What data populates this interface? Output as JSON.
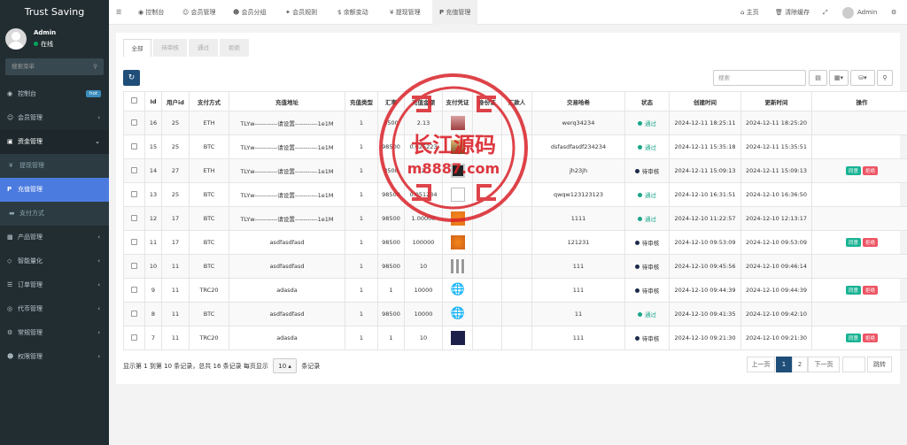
{
  "app": {
    "title": "Trust Saving"
  },
  "user": {
    "name": "Admin",
    "status": "在线"
  },
  "sidebar": {
    "search_placeholder": "搜索菜单",
    "items": [
      {
        "label": "控制台",
        "badge": "hot"
      },
      {
        "label": "会员管理"
      },
      {
        "label": "资金管理"
      },
      {
        "label": "提现管理"
      },
      {
        "label": "充值管理"
      },
      {
        "label": "支付方式"
      },
      {
        "label": "产品管理"
      },
      {
        "label": "智能量化"
      },
      {
        "label": "订单管理"
      },
      {
        "label": "代币管理"
      },
      {
        "label": "常规管理"
      },
      {
        "label": "权限管理"
      }
    ]
  },
  "topnav": {
    "tabs": [
      "控制台",
      "会员管理",
      "会员分组",
      "会员规则",
      "余额变动",
      "提现管理",
      "充值管理"
    ],
    "right": {
      "home": "主页",
      "clear_cache": "清除缓存",
      "admin": "Admin"
    }
  },
  "filter_tabs": [
    "全部",
    "待审核",
    "通过",
    "拒绝"
  ],
  "toolbar": {
    "search_placeholder": "搜索"
  },
  "table": {
    "headers": [
      "Id",
      "用户id",
      "支付方式",
      "充值地址",
      "充值类型",
      "汇率",
      "充值金额",
      "支付凭证",
      "身份证",
      "汇款人",
      "交易哈希",
      "状态",
      "创建时间",
      "更新时间",
      "操作"
    ],
    "rows": [
      {
        "id": "16",
        "uid": "25",
        "pay": "ETH",
        "addr": "TLYw-----------请设置-----------1e1M",
        "type": "1",
        "rate": "3500",
        "amount": "2.13",
        "hash": "werq34234",
        "status": "通过",
        "created": "2024-12-11 18:25:11",
        "updated": "2024-12-11 18:25:20",
        "ops": false
      },
      {
        "id": "15",
        "uid": "25",
        "pay": "BTC",
        "addr": "TLYw-----------请设置-----------1e1M",
        "type": "1",
        "rate": "98500",
        "amount": "0.025223",
        "hash": "dsfasdfasdf234234",
        "status": "通过",
        "created": "2024-12-11 15:35:18",
        "updated": "2024-12-11 15:35:51",
        "ops": false
      },
      {
        "id": "14",
        "uid": "27",
        "pay": "ETH",
        "addr": "TLYw-----------请设置-----------1e1M",
        "type": "1",
        "rate": "3500",
        "amount": "2",
        "hash": "jh23jh",
        "status": "待审核",
        "created": "2024-12-11 15:09:13",
        "updated": "2024-12-11 15:09:13",
        "ops": true
      },
      {
        "id": "13",
        "uid": "25",
        "pay": "BTC",
        "addr": "TLYw-----------请设置-----------1e1M",
        "type": "1",
        "rate": "98500",
        "amount": "0.051234",
        "hash": "qwqw123123123",
        "status": "通过",
        "created": "2024-12-10 16:31:51",
        "updated": "2024-12-10 16:36:50",
        "ops": false
      },
      {
        "id": "12",
        "uid": "17",
        "pay": "BTC",
        "addr": "TLYw-----------请设置-----------1e1M",
        "type": "1",
        "rate": "98500",
        "amount": "1.00000",
        "hash": "1111",
        "status": "通过",
        "created": "2024-12-10 11:22:57",
        "updated": "2024-12-10 12:13:17",
        "ops": false
      },
      {
        "id": "11",
        "uid": "17",
        "pay": "BTC",
        "addr": "asdfasdfasd",
        "type": "1",
        "rate": "98500",
        "amount": "100000",
        "hash": "121231",
        "status": "待审核",
        "created": "2024-12-10 09:53:09",
        "updated": "2024-12-10 09:53:09",
        "ops": true
      },
      {
        "id": "10",
        "uid": "11",
        "pay": "BTC",
        "addr": "asdfasdfasd",
        "type": "1",
        "rate": "98500",
        "amount": "10",
        "hash": "111",
        "status": "待审核",
        "created": "2024-12-10 09:45:56",
        "updated": "2024-12-10 09:46:14",
        "ops": false
      },
      {
        "id": "9",
        "uid": "11",
        "pay": "TRC20",
        "addr": "adasda",
        "type": "1",
        "rate": "1",
        "amount": "10000",
        "hash": "111",
        "status": "待审核",
        "created": "2024-12-10 09:44:39",
        "updated": "2024-12-10 09:44:39",
        "ops": true
      },
      {
        "id": "8",
        "uid": "11",
        "pay": "BTC",
        "addr": "asdfasdfasd",
        "type": "1",
        "rate": "98500",
        "amount": "10000",
        "hash": "11",
        "status": "通过",
        "created": "2024-12-10 09:41:35",
        "updated": "2024-12-10 09:42:10",
        "ops": false
      },
      {
        "id": "7",
        "uid": "11",
        "pay": "TRC20",
        "addr": "adasda",
        "type": "1",
        "rate": "1",
        "amount": "10",
        "hash": "111",
        "status": "待审核",
        "created": "2024-12-10 09:21:30",
        "updated": "2024-12-10 09:21:30",
        "ops": true
      }
    ],
    "actions": {
      "approve": "同意",
      "reject": "拒绝"
    }
  },
  "footer": {
    "info_prefix": "显示第 1 到第 10 条记录，总共 16 条记录 每页显示",
    "page_size": "10",
    "info_suffix": "条记录"
  },
  "pagination": {
    "prev": "上一页",
    "pages": [
      "1",
      "2"
    ],
    "next": "下一页",
    "go": "跳转"
  },
  "watermark": {
    "text1": "长江源码",
    "text2": "m8887.com"
  },
  "colors": {
    "sidebar_bg": "#222d32",
    "active_menu": "#4c7be0",
    "ok": "#18a689",
    "approve": "#1ab394",
    "reject": "#ed5565",
    "watermark": "#d9232a"
  }
}
